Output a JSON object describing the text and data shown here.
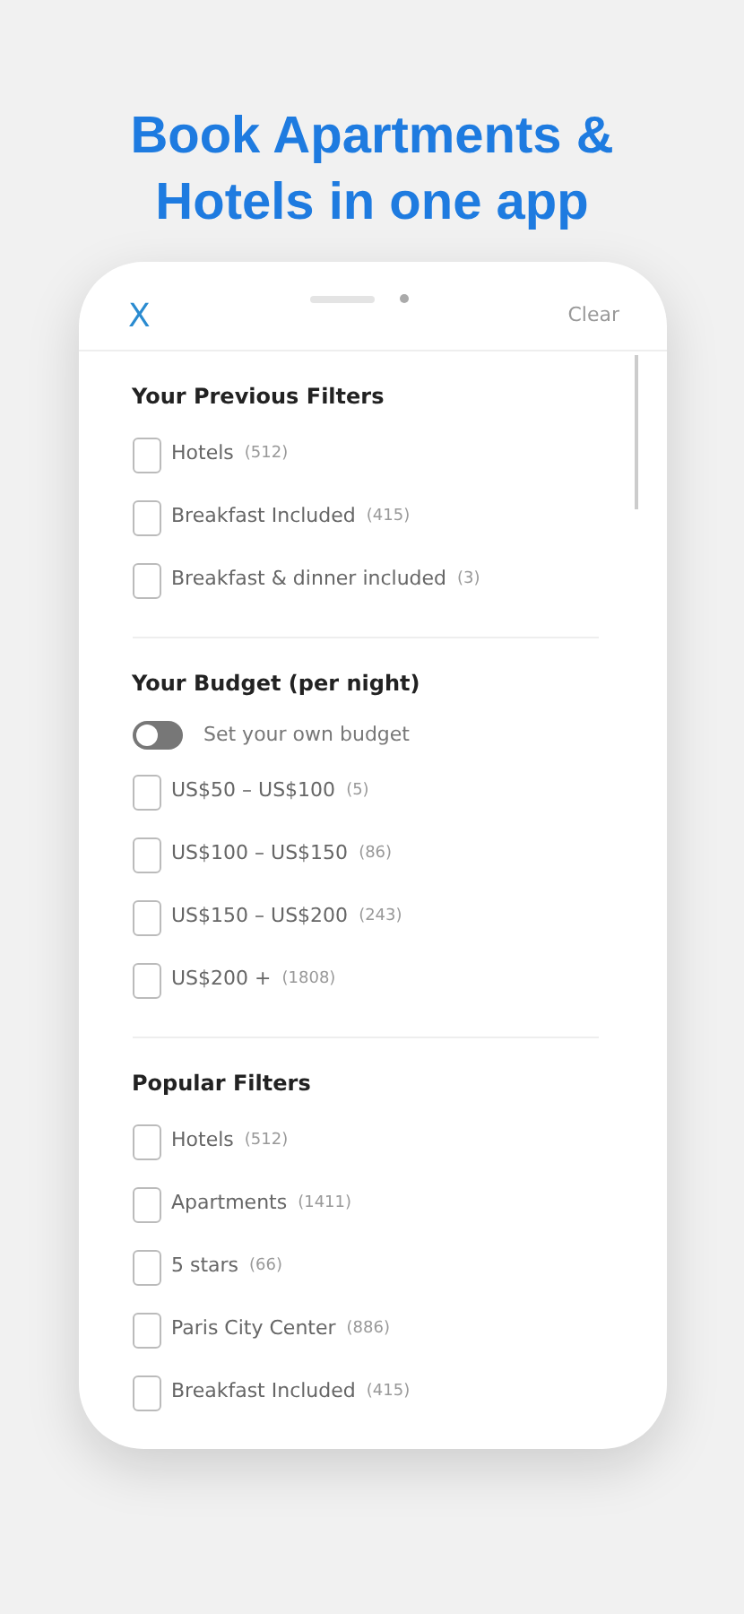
{
  "headline": "Book Apartments & Hotels in one app",
  "header": {
    "close": "X",
    "clear": "Clear"
  },
  "sections": [
    {
      "title": "Your Previous Filters",
      "items": [
        {
          "kind": "checkbox",
          "label": "Hotels",
          "count": "(512)",
          "checked": false
        },
        {
          "kind": "checkbox",
          "label": "Breakfast Included",
          "count": "(415)",
          "checked": false
        },
        {
          "kind": "checkbox",
          "label": "Breakfast & dinner included",
          "count": "(3)",
          "checked": false
        }
      ]
    },
    {
      "title": "Your Budget (per night)",
      "items": [
        {
          "kind": "toggle",
          "label": "Set your own budget",
          "on": false
        },
        {
          "kind": "checkbox",
          "label": "US$50 – US$100",
          "count": "(5)",
          "checked": false
        },
        {
          "kind": "checkbox",
          "label": "US$100 – US$150",
          "count": "(86)",
          "checked": false
        },
        {
          "kind": "checkbox",
          "label": "US$150 – US$200",
          "count": "(243)",
          "checked": false
        },
        {
          "kind": "checkbox",
          "label": "US$200 +",
          "count": "(1808)",
          "checked": false
        }
      ]
    },
    {
      "title": "Popular Filters",
      "items": [
        {
          "kind": "checkbox",
          "label": "Hotels",
          "count": "(512)",
          "checked": false
        },
        {
          "kind": "checkbox",
          "label": "Apartments",
          "count": "(1411)",
          "checked": false
        },
        {
          "kind": "checkbox",
          "label": "5 stars",
          "count": "(66)",
          "checked": false
        },
        {
          "kind": "checkbox",
          "label": "Paris City Center",
          "count": "(886)",
          "checked": false
        },
        {
          "kind": "checkbox",
          "label": "Breakfast Included",
          "count": "(415)",
          "checked": false
        }
      ]
    }
  ]
}
